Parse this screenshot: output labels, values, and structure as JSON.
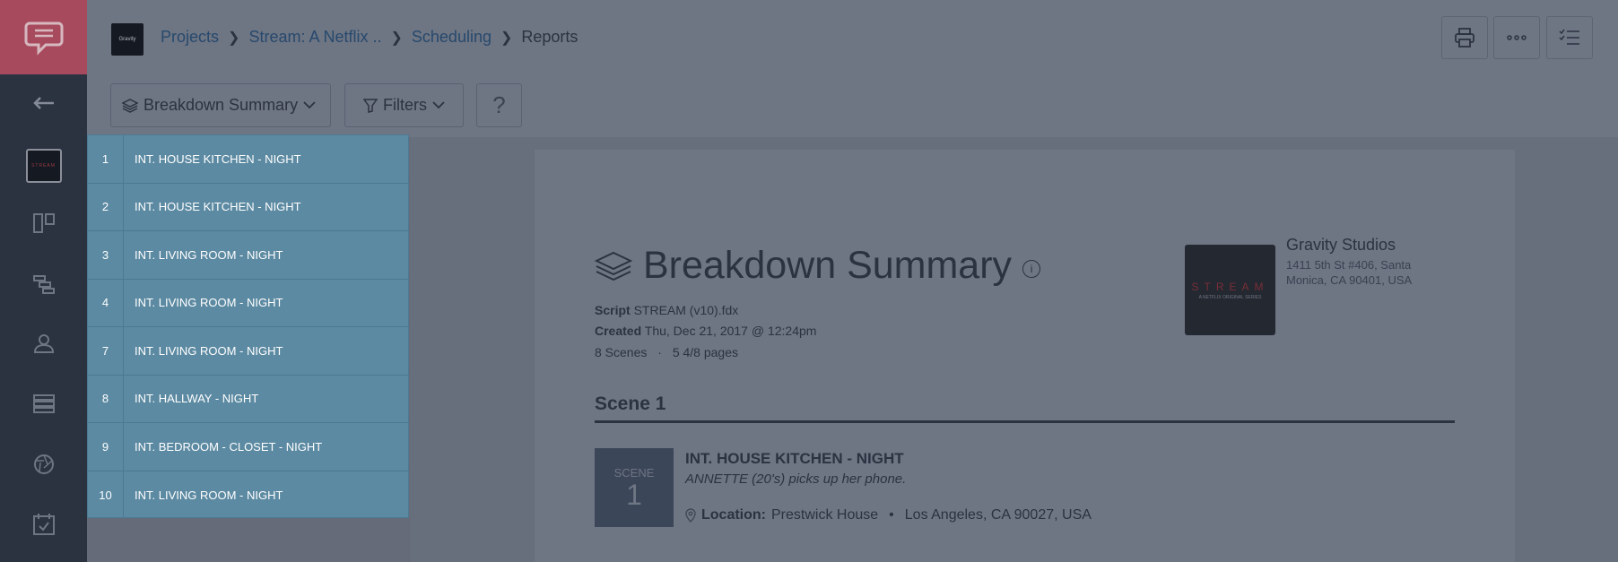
{
  "rail": {
    "items": [
      "chat-logo-icon",
      "back-arrow-icon",
      "project-thumbnail",
      "board-icon",
      "stripboard-icon",
      "contacts-icon",
      "list-icon",
      "aperture-icon",
      "calendar-icon"
    ]
  },
  "header": {
    "project_logo_text": "Gravity",
    "breadcrumb": {
      "projects": "Projects",
      "project": "Stream: A Netflix ..",
      "section": "Scheduling",
      "current": "Reports"
    }
  },
  "toolbar": {
    "report_select": "Breakdown Summary",
    "filters": "Filters",
    "help": "?"
  },
  "scene_list": [
    {
      "num": "1",
      "name": "INT. HOUSE KITCHEN - NIGHT"
    },
    {
      "num": "2",
      "name": "INT. HOUSE KITCHEN - NIGHT"
    },
    {
      "num": "3",
      "name": "INT. LIVING ROOM - NIGHT"
    },
    {
      "num": "4",
      "name": "INT. LIVING ROOM - NIGHT"
    },
    {
      "num": "7",
      "name": "INT. LIVING ROOM - NIGHT"
    },
    {
      "num": "8",
      "name": "INT. HALLWAY - NIGHT"
    },
    {
      "num": "9",
      "name": "INT. BEDROOM - CLOSET - NIGHT"
    },
    {
      "num": "10",
      "name": "INT. LIVING ROOM - NIGHT"
    }
  ],
  "report": {
    "title": "Breakdown Summary",
    "info_glyph": "i",
    "script_label": "Script",
    "script_value": "STREAM (v10).fdx",
    "created_label": "Created",
    "created_value": "Thu, Dec 21, 2017 @ 12:24pm",
    "scenes_count": "8 Scenes",
    "pages_count": "5 4/8 pages",
    "studio": {
      "thumb_title": "STREAM",
      "thumb_sub": "A NETFLIX ORIGINAL SERIES",
      "name": "Gravity Studios",
      "address": "1411 5th St #406, Santa Monica, CA 90401, USA"
    },
    "scene": {
      "heading": "Scene 1",
      "box_label": "SCENE",
      "box_number": "1",
      "name": "INT. HOUSE KITCHEN - NIGHT",
      "description": "ANNETTE (20's) picks up her phone.",
      "location_label": "Location:",
      "location_name": "Prestwick House",
      "location_address": "Los Angeles, CA 90027, USA"
    }
  }
}
